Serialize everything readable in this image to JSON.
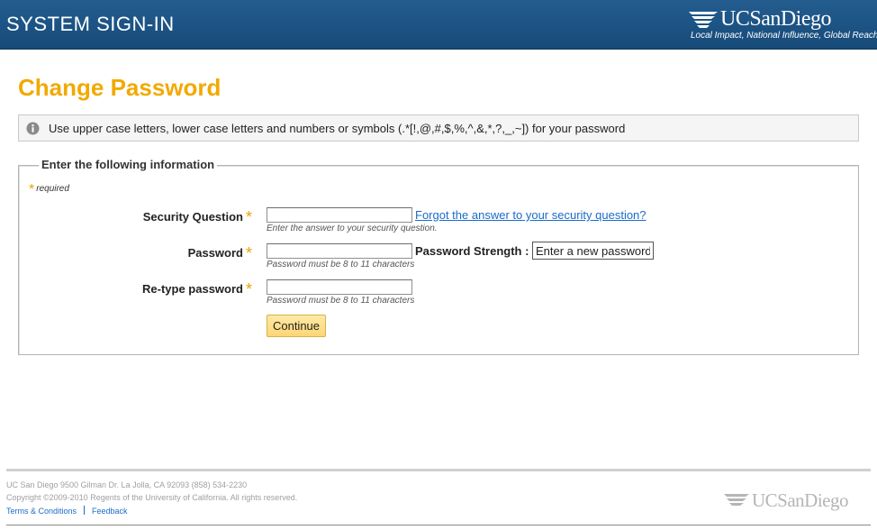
{
  "header": {
    "title": "SYSTEM SIGN-IN",
    "logo_text": "UCSanDiego",
    "logo_tagline": "Local Impact, National Influence, Global Reach",
    "background": "#1c5485"
  },
  "page": {
    "title": "Change Password",
    "title_color": "#f2a900"
  },
  "info": {
    "icon": "info-icon",
    "text": "Use upper case letters, lower case letters and numbers or symbols (.*[!,@,#,$,%,^,&,*,?,_,~]) for your password"
  },
  "form": {
    "legend": "Enter the following information",
    "required_note": "required",
    "required_marker": "*",
    "security_question": {
      "label": "Security Question",
      "value": "",
      "link": "Forgot the answer to your security question?",
      "hint": "Enter the answer to your security question."
    },
    "password": {
      "label": "Password",
      "value": "",
      "strength_label": "Password Strength :",
      "strength_value": "Enter a new password",
      "hint": "Password must be 8 to 11 characters"
    },
    "retype_password": {
      "label": "Re-type password",
      "value": "",
      "hint": "Password must be 8 to 11 characters"
    },
    "submit_label": "Continue"
  },
  "footer": {
    "address": "UC San Diego 9500 Gilman Dr. La Jolla, CA 92093 (858) 534-2230",
    "copyright": "Copyright ©2009-2010 Regents of the University of California. All rights reserved.",
    "links": [
      "Terms & Conditions",
      "Feedback"
    ],
    "logo_text": "UCSanDiego"
  }
}
